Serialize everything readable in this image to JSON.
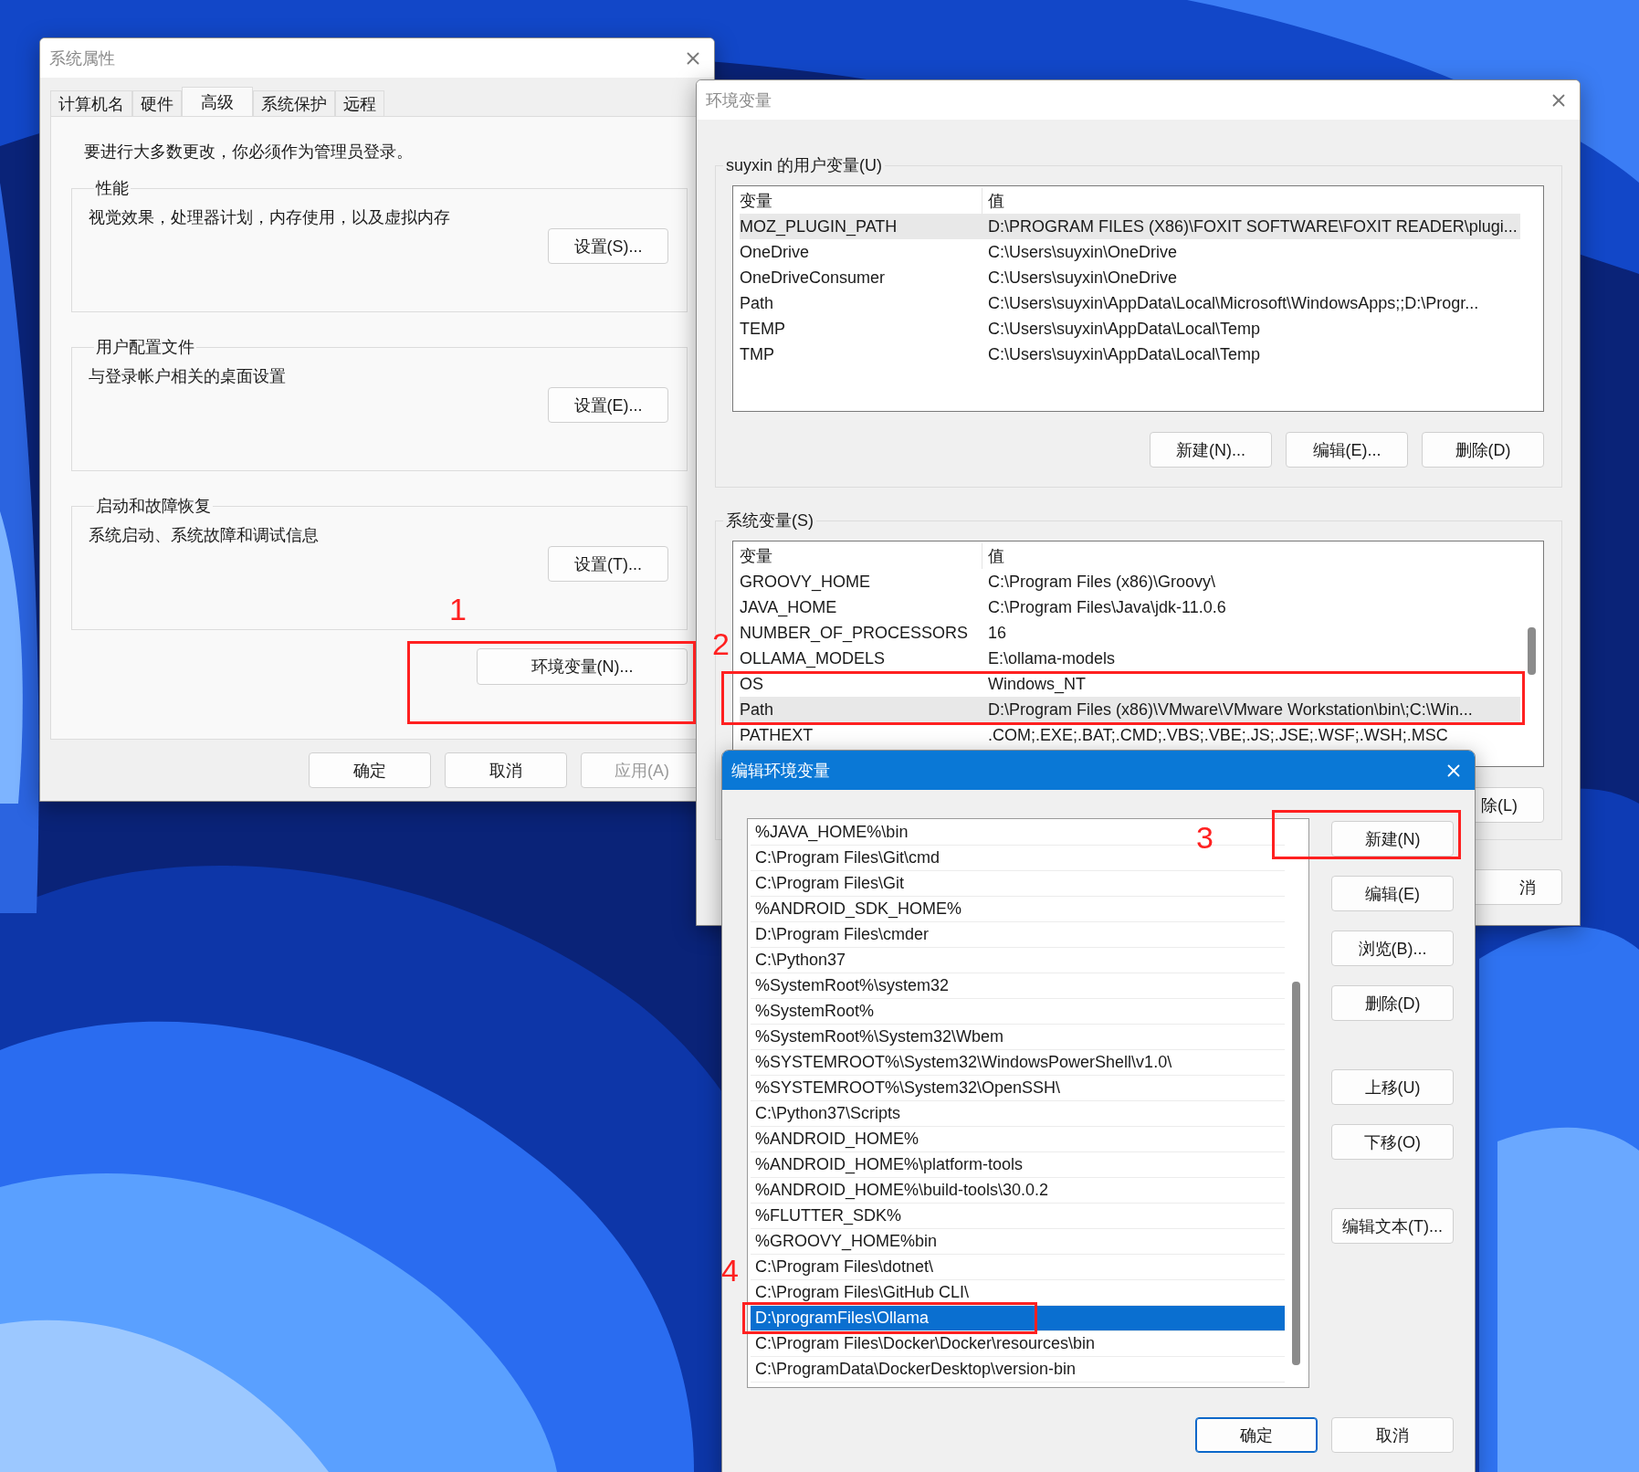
{
  "system_properties": {
    "title": "系统属性",
    "tabs": [
      {
        "label": "计算机名",
        "selected": false
      },
      {
        "label": "硬件",
        "selected": false
      },
      {
        "label": "高级",
        "selected": true
      },
      {
        "label": "系统保护",
        "selected": false
      },
      {
        "label": "远程",
        "selected": false
      }
    ],
    "notice": "要进行大多数更改，你必须作为管理员登录。",
    "groups": [
      {
        "legend": "性能",
        "description": "视觉效果，处理器计划，内存使用，以及虚拟内存",
        "button": "设置(S)..."
      },
      {
        "legend": "用户配置文件",
        "description": "与登录帐户相关的桌面设置",
        "button": "设置(E)..."
      },
      {
        "legend": "启动和故障恢复",
        "description": "系统启动、系统故障和调试信息",
        "button": "设置(T)..."
      }
    ],
    "env_button": "环境变量(N)...",
    "buttons": [
      {
        "label": "确定",
        "disabled": false
      },
      {
        "label": "取消",
        "disabled": false
      },
      {
        "label": "应用(A)",
        "disabled": true
      }
    ]
  },
  "environment_variables": {
    "title": "环境变量",
    "user_variables": {
      "legend": "suyxin 的用户变量(U)",
      "columns": [
        "变量",
        "值"
      ],
      "rows": [
        {
          "name": "MOZ_PLUGIN_PATH",
          "value": "D:\\PROGRAM FILES (X86)\\FOXIT SOFTWARE\\FOXIT READER\\plugi...",
          "selected": true
        },
        {
          "name": "OneDrive",
          "value": "C:\\Users\\suyxin\\OneDrive",
          "selected": false
        },
        {
          "name": "OneDriveConsumer",
          "value": "C:\\Users\\suyxin\\OneDrive",
          "selected": false
        },
        {
          "name": "Path",
          "value": "C:\\Users\\suyxin\\AppData\\Local\\Microsoft\\WindowsApps;;D:\\Progr...",
          "selected": false
        },
        {
          "name": "TEMP",
          "value": "C:\\Users\\suyxin\\AppData\\Local\\Temp",
          "selected": false
        },
        {
          "name": "TMP",
          "value": "C:\\Users\\suyxin\\AppData\\Local\\Temp",
          "selected": false
        }
      ],
      "buttons": [
        "新建(N)...",
        "编辑(E)...",
        "删除(D)"
      ]
    },
    "system_variables": {
      "legend": "系统变量(S)",
      "columns": [
        "变量",
        "值"
      ],
      "rows": [
        {
          "name": "GROOVY_HOME",
          "value": "C:\\Program Files (x86)\\Groovy\\",
          "selected": false
        },
        {
          "name": "JAVA_HOME",
          "value": "C:\\Program Files\\Java\\jdk-11.0.6",
          "selected": false
        },
        {
          "name": "NUMBER_OF_PROCESSORS",
          "value": "16",
          "selected": false
        },
        {
          "name": "OLLAMA_MODELS",
          "value": "E:\\ollama-models",
          "selected": false
        },
        {
          "name": "OS",
          "value": "Windows_NT",
          "selected": false
        },
        {
          "name": "Path",
          "value": "D:\\Program Files (x86)\\VMware\\VMware Workstation\\bin\\;C:\\Win...",
          "selected": true
        },
        {
          "name": "PATHEXT",
          "value": ".COM;.EXE;.BAT;.CMD;.VBS;.VBE;.JS;.JSE;.WSF;.WSH;.MSC",
          "selected": false
        }
      ],
      "buttons": [
        "除(L)"
      ]
    },
    "buttons": [
      "消"
    ]
  },
  "edit_dialog": {
    "title": "编辑环境变量",
    "entries": [
      {
        "text": "%JAVA_HOME%\\bin",
        "selected": false
      },
      {
        "text": "C:\\Program Files\\Git\\cmd",
        "selected": false
      },
      {
        "text": "C:\\Program Files\\Git",
        "selected": false
      },
      {
        "text": "%ANDROID_SDK_HOME%",
        "selected": false
      },
      {
        "text": "D:\\Program Files\\cmder",
        "selected": false
      },
      {
        "text": "C:\\Python37",
        "selected": false
      },
      {
        "text": "%SystemRoot%\\system32",
        "selected": false
      },
      {
        "text": "%SystemRoot%",
        "selected": false
      },
      {
        "text": "%SystemRoot%\\System32\\Wbem",
        "selected": false
      },
      {
        "text": "%SYSTEMROOT%\\System32\\WindowsPowerShell\\v1.0\\",
        "selected": false
      },
      {
        "text": "%SYSTEMROOT%\\System32\\OpenSSH\\",
        "selected": false
      },
      {
        "text": "C:\\Python37\\Scripts",
        "selected": false
      },
      {
        "text": "%ANDROID_HOME%",
        "selected": false
      },
      {
        "text": "%ANDROID_HOME%\\platform-tools",
        "selected": false
      },
      {
        "text": "%ANDROID_HOME%\\build-tools\\30.0.2",
        "selected": false
      },
      {
        "text": "%FLUTTER_SDK%",
        "selected": false
      },
      {
        "text": "%GROOVY_HOME%bin",
        "selected": false
      },
      {
        "text": "C:\\Program Files\\dotnet\\",
        "selected": false
      },
      {
        "text": "C:\\Program Files\\GitHub CLI\\",
        "selected": false
      },
      {
        "text": "D:\\programFiles\\Ollama",
        "selected": true
      },
      {
        "text": "C:\\Program Files\\Docker\\Docker\\resources\\bin",
        "selected": false
      },
      {
        "text": "C:\\ProgramData\\DockerDesktop\\version-bin",
        "selected": false
      }
    ],
    "side_button_groups": [
      [
        "新建(N)",
        "编辑(E)",
        "浏览(B)...",
        "删除(D)"
      ],
      [
        "上移(U)",
        "下移(O)"
      ],
      [
        "编辑文本(T)..."
      ]
    ],
    "buttons": [
      {
        "label": "确定",
        "default": true
      },
      {
        "label": "取消",
        "default": false
      }
    ]
  },
  "annotations": [
    {
      "label": "1"
    },
    {
      "label": "2"
    },
    {
      "label": "3"
    },
    {
      "label": "4"
    }
  ]
}
